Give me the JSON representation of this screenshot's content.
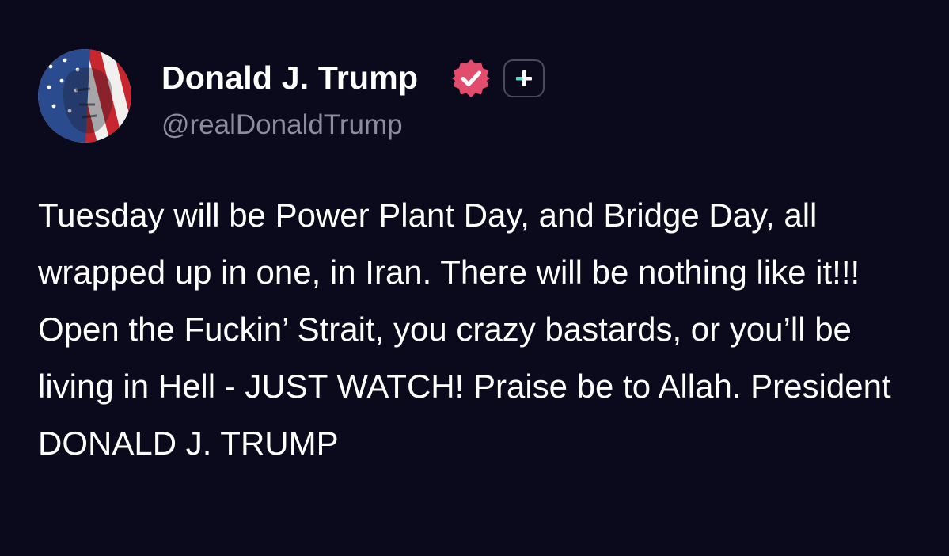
{
  "author": {
    "display_name": "Donald J. Trump",
    "handle": "@realDonaldTrump",
    "avatar_icon": "flag-portrait-avatar",
    "verified_icon": "verified-badge-icon",
    "verified_color": "#e24d6e",
    "follow_icon": "plus-icon",
    "follow_accent": "#5fd6c3"
  },
  "post": {
    "text": "Tuesday will be Power Plant Day, and Bridge Day, all wrapped up in one, in Iran. There will be nothing like it!!! Open the Fuckin’ Strait, you crazy bastards, or you’ll be living in Hell - JUST WATCH! Praise be to Allah. President DONALD J. TRUMP"
  },
  "theme": {
    "background": "#0b0a1c",
    "text": "#ffffff",
    "muted_text": "#8d8c9c"
  }
}
